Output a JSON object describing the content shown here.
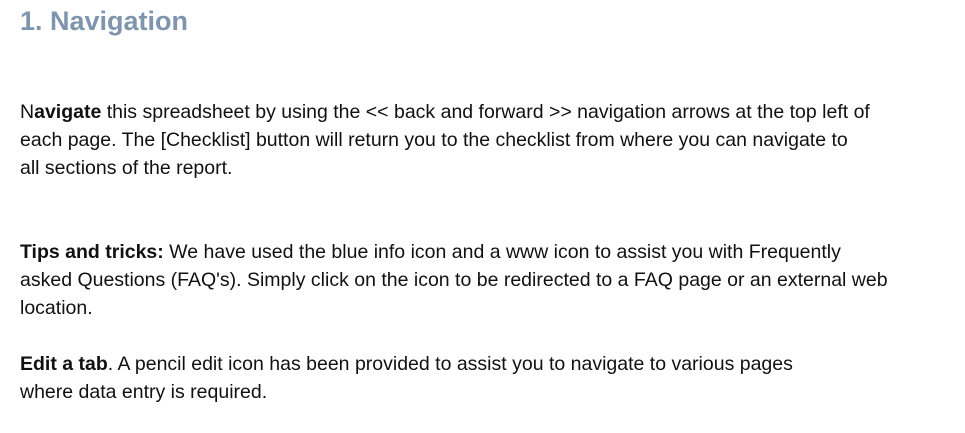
{
  "heading": "1. Navigation",
  "navigate_paragraph": {
    "lead_plain": "N",
    "lead_bold": "avigate",
    "line1": " this spreadsheet by using the << back and forward >> navigation arrows at the top left of",
    "line2": "each page.  The [Checklist] button will return you to the checklist from where you can  navigate to",
    "line3": "all sections of the report."
  },
  "tips_paragraph": {
    "label": "Tips and tricks:",
    "line1": "  We have used the blue info icon and a www icon to assist you with Frequently",
    "line2": "asked Questions (FAQ's). Simply click on the icon to be redirected to a FAQ page or an external web",
    "line3": "location."
  },
  "edit_paragraph": {
    "label": "Edit a tab",
    "line1": ".  A pencil edit icon has been provided to assist you to navigate to various pages",
    "line2": "where data entry is required."
  },
  "colors": {
    "heading": "#7f95ae",
    "text": "#111111",
    "background": "#ffffff"
  }
}
